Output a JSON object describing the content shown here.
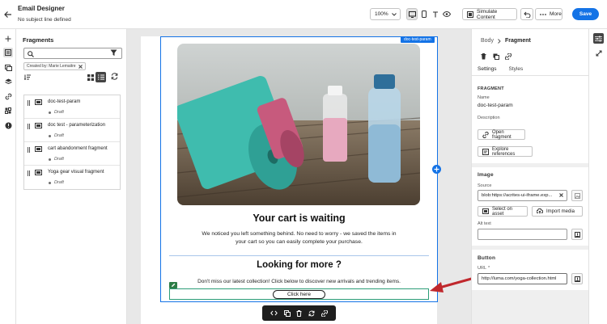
{
  "header": {
    "title": "Email Designer",
    "subtitle": "No subject line defined",
    "zoom": "100%",
    "simulate_label": "Simulate Content",
    "more_label": "More",
    "save_label": "Save"
  },
  "fragments_panel": {
    "title": "Fragments",
    "search_placeholder": "",
    "filter_chip": "Created by: Marie Lemaitre",
    "items": [
      {
        "name": "doc-test-param",
        "status": "Draft"
      },
      {
        "name": "doc test - parameterization",
        "status": "Draft"
      },
      {
        "name": "cart abandonment fragment",
        "status": "Draft"
      },
      {
        "name": "Yoga gear visual fragment",
        "status": "Draft"
      }
    ]
  },
  "canvas": {
    "selection_tag": "doc-test-param",
    "heading_1": "Your cart is waiting",
    "paragraph_1": "We noticed you left something behind. No need to worry - we saved the items in your cart so you can easily complete your purchase.",
    "heading_2": "Looking for more ?",
    "paragraph_2": "Don't miss our latest collection! Click below to discover new arrivals and trending items.",
    "button_label": "Click here"
  },
  "right_panel": {
    "breadcrumb_parent": "Body",
    "breadcrumb_current": "Fragment",
    "tab_settings": "Settings",
    "tab_styles": "Styles",
    "fragment_section": "FRAGMENT",
    "name_label": "Name",
    "name_value": "doc-test-param",
    "description_label": "Description",
    "open_fragment_label": "Open fragment",
    "explore_references_label": "Explore references",
    "image_section": "Image",
    "source_label": "Source",
    "source_value": "blob:https://acrites-ui-iframe.exp...",
    "select_asset_label": "Select on asset",
    "import_media_label": "Import media",
    "alt_text_label": "Alt text",
    "alt_text_value": "",
    "button_section": "Button",
    "url_label": "URL",
    "url_value": "http://luma.com/yoga-collection.html"
  },
  "colors": {
    "accent": "#1473e6",
    "selected_border": "#2d9d78",
    "annotation_arrow": "#c0282d"
  }
}
